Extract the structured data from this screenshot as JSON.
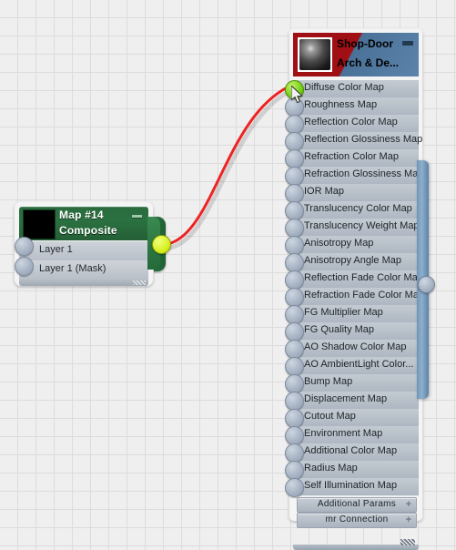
{
  "canvas": {
    "background_color": "#efefef",
    "grid_color": "#dcdcdc",
    "grid_size": 20
  },
  "map_node": {
    "title_line1": "Map #14",
    "title_line2": "Composite",
    "header_color": "#2b7140",
    "minimize_label": "",
    "inputs": [
      {
        "label": "Layer 1",
        "connected": false
      },
      {
        "label": "Layer 1 (Mask)",
        "connected": false
      }
    ],
    "output": {
      "label": "",
      "connected": true,
      "color": "#d9f22a"
    }
  },
  "material_node": {
    "title_line1": "Shop-Door",
    "title_line2": "Arch & De...",
    "title_color_left": "#a00f13",
    "title_color_right": "#5c83ab",
    "minimize_label": "",
    "slots": [
      {
        "label": "Diffuse Color Map",
        "connected": true
      },
      {
        "label": "Roughness Map",
        "connected": false
      },
      {
        "label": "Reflection Color Map",
        "connected": false
      },
      {
        "label": "Reflection Glossiness Map",
        "connected": false
      },
      {
        "label": "Refraction Color Map",
        "connected": false
      },
      {
        "label": "Refraction Glossiness Map",
        "connected": false
      },
      {
        "label": "IOR Map",
        "connected": false
      },
      {
        "label": "Translucency Color Map",
        "connected": false
      },
      {
        "label": "Translucency Weight Map",
        "connected": false
      },
      {
        "label": "Anisotropy Map",
        "connected": false
      },
      {
        "label": "Anisotropy Angle Map",
        "connected": false
      },
      {
        "label": "Reflection Fade Color Map",
        "connected": false
      },
      {
        "label": "Refraction Fade Color Map",
        "connected": false
      },
      {
        "label": "FG Multiplier Map",
        "connected": false
      },
      {
        "label": "FG Quality Map",
        "connected": false
      },
      {
        "label": "AO Shadow Color Map",
        "connected": false
      },
      {
        "label": "AO AmbientLight Color...",
        "connected": false
      },
      {
        "label": "Bump Map",
        "connected": false
      },
      {
        "label": "Displacement Map",
        "connected": false
      },
      {
        "label": "Cutout Map",
        "connected": false
      },
      {
        "label": "Environment Map",
        "connected": false
      },
      {
        "label": "Additional Color Map",
        "connected": false
      },
      {
        "label": "Radius Map",
        "connected": false
      },
      {
        "label": "Self Illumination Map",
        "connected": false
      }
    ],
    "rollouts": [
      {
        "label": "Additional Params",
        "expander": "+"
      },
      {
        "label": "mr Connection",
        "expander": "+"
      }
    ]
  },
  "wire": {
    "color": "#ee2222",
    "from": "map_node.output",
    "to": "material_node.slots.0"
  },
  "scrollbar": {
    "color": "#7aa0c4",
    "handle_position_pct": 49
  }
}
